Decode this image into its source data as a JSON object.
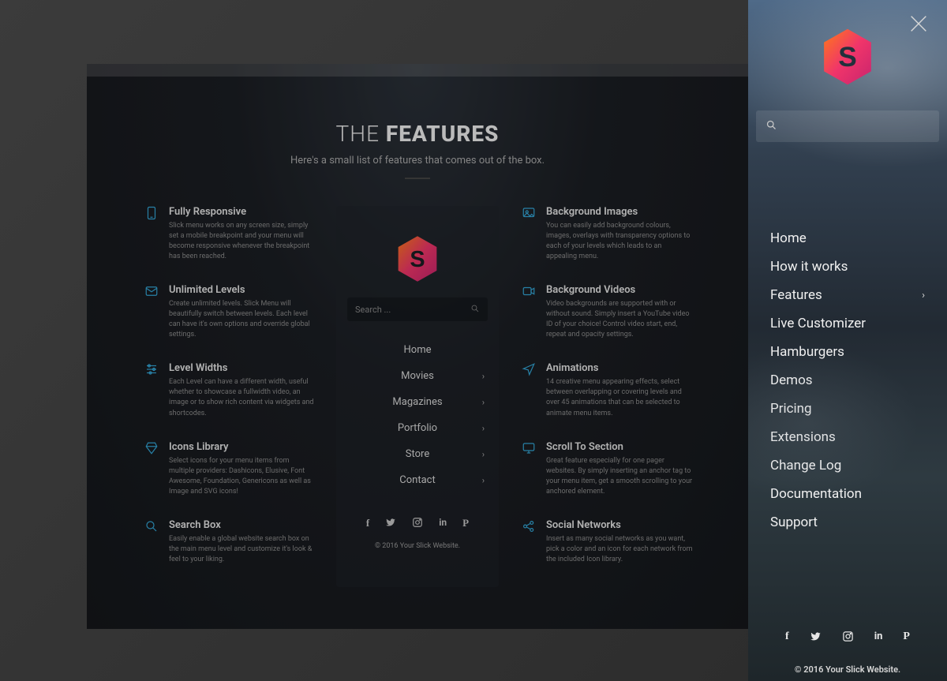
{
  "inner": {
    "title_light": "THE",
    "title_bold": "FEATURES",
    "subtitle": "Here's a small list of features that comes out of the box.",
    "left": [
      {
        "title": "Fully Responsive",
        "desc": "Slick menu works on any screen size, simply set a mobile breakpoint and your menu will become responsive whenever the breakpoint has been reached."
      },
      {
        "title": "Unlimited Levels",
        "desc": "Create unlimited levels. Slick Menu will beautifully switch between levels. Each level can have it's own options and override global settings."
      },
      {
        "title": "Level Widths",
        "desc": "Each Level can have a different width, useful whether to showcase a fullwidth video, an image or to show rich content via widgets and shortcodes."
      },
      {
        "title": "Icons Library",
        "desc": "Select icons for your menu items from multiple providers: Dashicons, Elusive, Font Awesome, Foundation, Genericons as well as Image and SVG icons!"
      },
      {
        "title": "Search Box",
        "desc": "Easily enable a global website search box on the main menu level and customize it's look & feel to your liking."
      }
    ],
    "right": [
      {
        "title": "Background Images",
        "desc": "You can easily add background colours, images, overlays with transparency options to each of your levels which leads to an appealing menu."
      },
      {
        "title": "Background Videos",
        "desc": "Video backgrounds are supported with or without sound. Simply insert a YouTube video ID of your choice! Control video start, end, repeat and opacity settings."
      },
      {
        "title": "Animations",
        "desc": "14 creative menu appearing effects, select between overlapping or covering levels and over 45 animations that can be selected to animate menu items."
      },
      {
        "title": "Scroll To Section",
        "desc": "Great feature especially for one pager websites. By simply inserting an anchor tag to your menu item, get a smooth scrolling to your anchored element."
      },
      {
        "title": "Social Networks",
        "desc": "Insert as many social networks as you want, pick a color and an icon for each network from the included Icon library."
      }
    ],
    "center": {
      "search_placeholder": "Search ...",
      "items": [
        {
          "label": "Home",
          "chev": false
        },
        {
          "label": "Movies",
          "chev": true
        },
        {
          "label": "Magazines",
          "chev": true
        },
        {
          "label": "Portfolio",
          "chev": true
        },
        {
          "label": "Store",
          "chev": true
        },
        {
          "label": "Contact",
          "chev": true
        }
      ],
      "copyright": "© 2016 Your Slick Website."
    }
  },
  "side": {
    "nav": [
      {
        "label": "Home",
        "chev": false
      },
      {
        "label": "How it works",
        "chev": false
      },
      {
        "label": "Features",
        "chev": true
      },
      {
        "label": "Live Customizer",
        "chev": false
      },
      {
        "label": "Hamburgers",
        "chev": false
      },
      {
        "label": "Demos",
        "chev": false
      },
      {
        "label": "Pricing",
        "chev": false
      },
      {
        "label": "Extensions",
        "chev": false
      },
      {
        "label": "Change Log",
        "chev": false
      },
      {
        "label": "Documentation",
        "chev": false
      },
      {
        "label": "Support",
        "chev": false
      }
    ],
    "socials": [
      "facebook",
      "twitter",
      "instagram",
      "linkedin",
      "pinterest"
    ],
    "copyright": "© 2016 Your Slick Website."
  },
  "glyphs": {
    "search": "🔍",
    "chev_right": "›",
    "facebook": "f",
    "twitter": "🐦",
    "instagram": "◻",
    "linkedin": "in",
    "pinterest": "P"
  }
}
